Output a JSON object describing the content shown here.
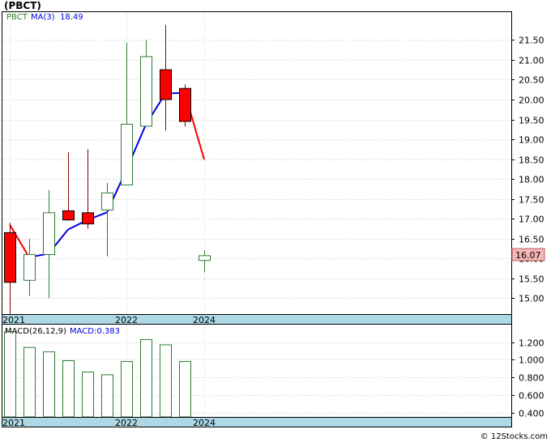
{
  "title": "(PBCT)",
  "watermark": "© 12Stocks.com",
  "colors": {
    "up": "#2e7d32",
    "down": "#ff0000",
    "ma": "#0000dd",
    "axis_band": "#add8e6",
    "price_tag_bg": "#f4b6b6",
    "grid": "#d0d0d0"
  },
  "chart_data": [
    {
      "type": "candlestick",
      "symbol": "PBCT",
      "ma_label": "MA(3)",
      "ma_value": "18.49",
      "last_price": "16.07",
      "ylim": [
        14.6,
        22.2
      ],
      "y_ticks": [
        "15.00",
        "15.50",
        "16.00",
        "16.50",
        "17.00",
        "17.50",
        "18.00",
        "18.50",
        "19.00",
        "19.50",
        "20.00",
        "20.50",
        "21.00",
        "21.50"
      ],
      "x_ticks": [
        "2021",
        "2022",
        "2024"
      ],
      "candles": [
        {
          "o": 16.65,
          "h": 16.9,
          "l": 14.6,
          "c": 15.4
        },
        {
          "o": 15.45,
          "h": 16.5,
          "l": 15.05,
          "c": 16.1
        },
        {
          "o": 16.1,
          "h": 17.72,
          "l": 15.0,
          "c": 17.15
        },
        {
          "o": 17.2,
          "h": 18.67,
          "l": 16.95,
          "c": 16.97
        },
        {
          "o": 17.15,
          "h": 18.75,
          "l": 16.75,
          "c": 16.87
        },
        {
          "o": 17.22,
          "h": 17.9,
          "l": 16.05,
          "c": 17.65
        },
        {
          "o": 17.85,
          "h": 21.43,
          "l": 17.85,
          "c": 19.38
        },
        {
          "o": 19.33,
          "h": 21.5,
          "l": 19.33,
          "c": 21.08
        },
        {
          "o": 20.75,
          "h": 21.88,
          "l": 19.22,
          "c": 20.0
        },
        {
          "o": 20.28,
          "h": 20.38,
          "l": 19.32,
          "c": 19.45
        },
        {
          "o": 15.95,
          "h": 16.2,
          "l": 15.65,
          "c": 16.07
        }
      ],
      "ma": [
        16.85,
        16.03,
        16.12,
        16.73,
        16.97,
        17.16,
        18.23,
        19.37,
        20.15,
        20.17,
        18.49
      ]
    },
    {
      "type": "bar",
      "label": "MACD(26,12,9)",
      "value_label": "MACD:0.383",
      "ylim": [
        0.35,
        1.4
      ],
      "y_ticks": [
        "0.400",
        "0.600",
        "0.800",
        "1.000",
        "1.200"
      ],
      "x_ticks": [
        "2021",
        "2022",
        "2024"
      ],
      "values": [
        1.32,
        1.14,
        1.09,
        0.99,
        0.86,
        0.83,
        0.98,
        1.23,
        1.17,
        0.98
      ]
    }
  ]
}
